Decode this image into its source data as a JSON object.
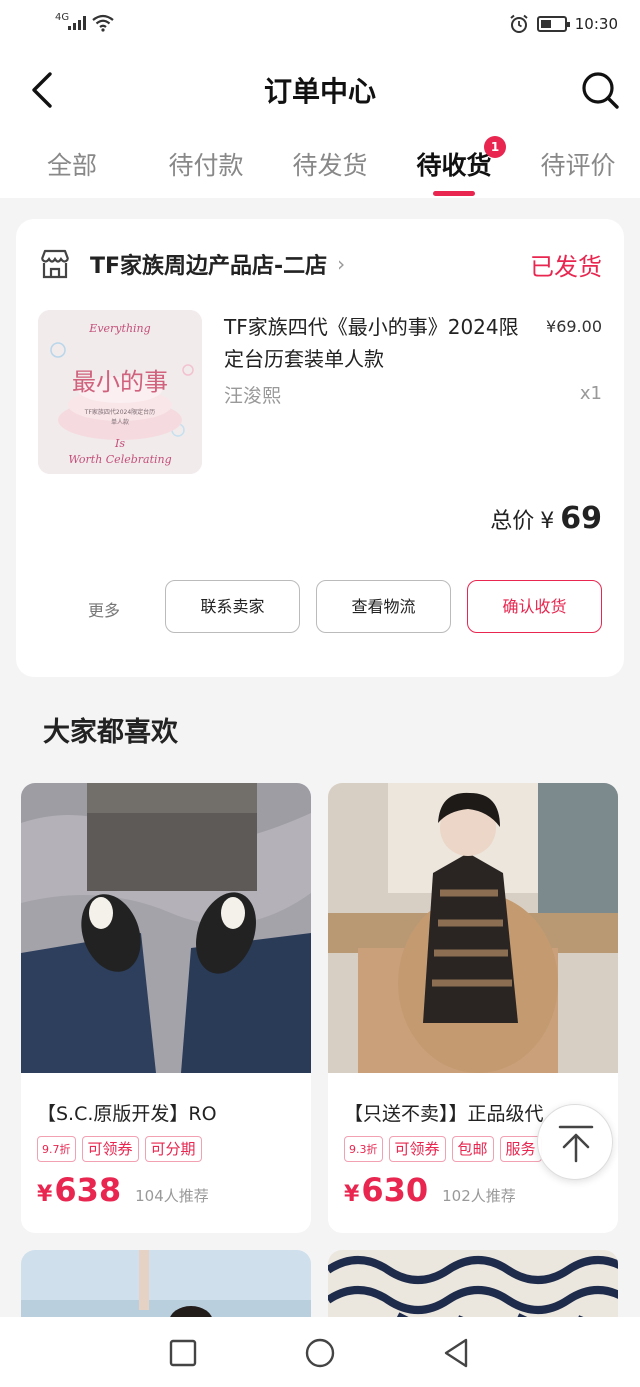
{
  "status_bar": {
    "network": "4G",
    "time": "10:30"
  },
  "header": {
    "title": "订单中心"
  },
  "tabs": [
    {
      "label": "全部"
    },
    {
      "label": "待付款"
    },
    {
      "label": "待发货"
    },
    {
      "label": "待收货",
      "badge": "1"
    },
    {
      "label": "待评价"
    }
  ],
  "order": {
    "store_name": "TF家族周边产品店-二店",
    "status": "已发货",
    "product_title": "TF家族四代《最小的事》2024限定台历套装单人款",
    "price": "¥69.00",
    "spec": "汪浚熙",
    "qty": "x1",
    "total_label": "总价",
    "total_currency": "¥",
    "total_value": "69",
    "more_label": "更多",
    "buttons": {
      "contact": "联系卖家",
      "logistics": "查看物流",
      "confirm": "确认收货"
    },
    "image_text": {
      "top": "Everything",
      "main": "最小的事",
      "sub": "TF家族四代2024限定台历",
      "sub2": "单人款",
      "bottom1": "Is",
      "bottom2": "Worth Celebrating"
    }
  },
  "recommend": {
    "title": "大家都喜欢",
    "items": [
      {
        "name": "【S.C.原版开发】RO",
        "tags": [
          "9.7折",
          "可领券",
          "可分期"
        ],
        "currency": "¥",
        "price": "638",
        "recommend_count": "104人推荐"
      },
      {
        "name": "【只送不卖】】正品级代",
        "tags": [
          "9.3折",
          "可领券",
          "包邮",
          "服务"
        ],
        "currency": "¥",
        "price": "630",
        "recommend_count": "102人推荐"
      }
    ]
  },
  "colors": {
    "accent": "#e8264f",
    "background": "#f4f4f5"
  },
  "icons": {
    "back": "chevron-left-icon",
    "search": "search-icon",
    "store": "store-icon",
    "back_to_top": "arrow-up-icon"
  }
}
